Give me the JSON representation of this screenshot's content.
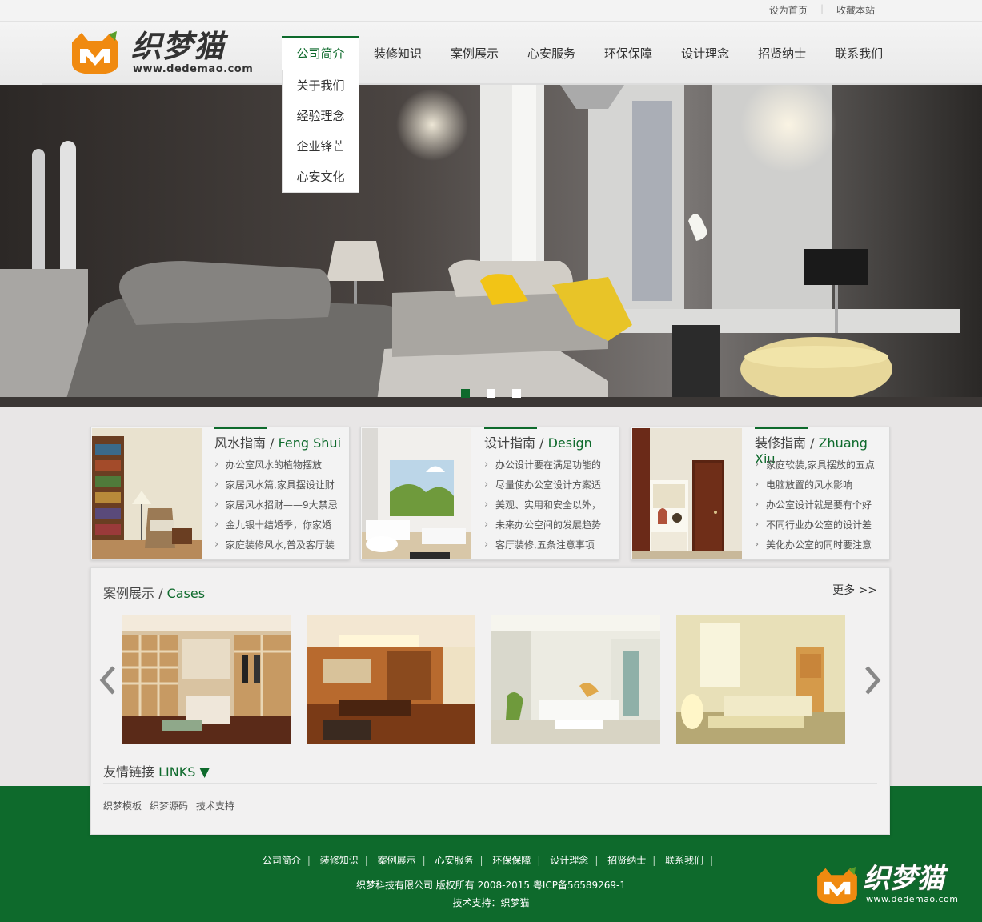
{
  "topbar": {
    "set_home": "设为首页",
    "bookmark": "收藏本站"
  },
  "logo": {
    "brand": "织梦猫",
    "url": "www.dedemao.com"
  },
  "nav": {
    "items": [
      "公司简介",
      "装修知识",
      "案例展示",
      "心安服务",
      "环保保障",
      "设计理念",
      "招贤纳士",
      "联系我们"
    ],
    "active_index": 0
  },
  "dropdown": {
    "items": [
      "关于我们",
      "经验理念",
      "企业锋芒",
      "心安文化"
    ]
  },
  "banner": {
    "slides": 3,
    "active_slide": 1
  },
  "guides": [
    {
      "title": "风水指南",
      "sep": " / ",
      "en": "Feng Shui",
      "items": [
        "办公室风水的植物摆放",
        "家居风水篇,家具摆设让财",
        "家居风水招财——9大禁忌",
        "金九银十结婚季，你家婚",
        "家庭装修风水,普及客厅装"
      ]
    },
    {
      "title": "设计指南",
      "sep": " / ",
      "en": "Design",
      "items": [
        "办公设计要在满足功能的",
        "尽量使办公室设计方案适",
        "美观、实用和安全以外，",
        "未来办公空间的发展趋势",
        "客厅装修,五条注意事项"
      ]
    },
    {
      "title": "装修指南",
      "sep": " / ",
      "en": "Zhuang Xiu",
      "items": [
        "家庭软装,家具摆放的五点",
        "电脑放置的风水影响",
        "办公室设计就是要有个好",
        "不同行业办公室的设计差",
        "美化办公室的同时要注意"
      ]
    }
  ],
  "cases": {
    "title": "案例展示",
    "sep": " / ",
    "en": "Cases",
    "more": "更多 >>",
    "links_title": "友情链接",
    "links_en": "LINKS ▼",
    "links": [
      "织梦模板",
      "织梦源码",
      "技术支持"
    ]
  },
  "footer": {
    "nav": [
      "公司简介",
      "装修知识",
      "案例展示",
      "心安服务",
      "环保保障",
      "设计理念",
      "招贤纳士",
      "联系我们"
    ],
    "copyright": "织梦科技有限公司 版权所有 2008-2015 粤ICP备56589269-1",
    "tech": "技术支持：织梦猫",
    "logo_brand": "织梦猫",
    "logo_url": "www.dedemao.com"
  },
  "colors": {
    "accent": "#0e6a2c",
    "logo_orange": "#f08a10"
  }
}
